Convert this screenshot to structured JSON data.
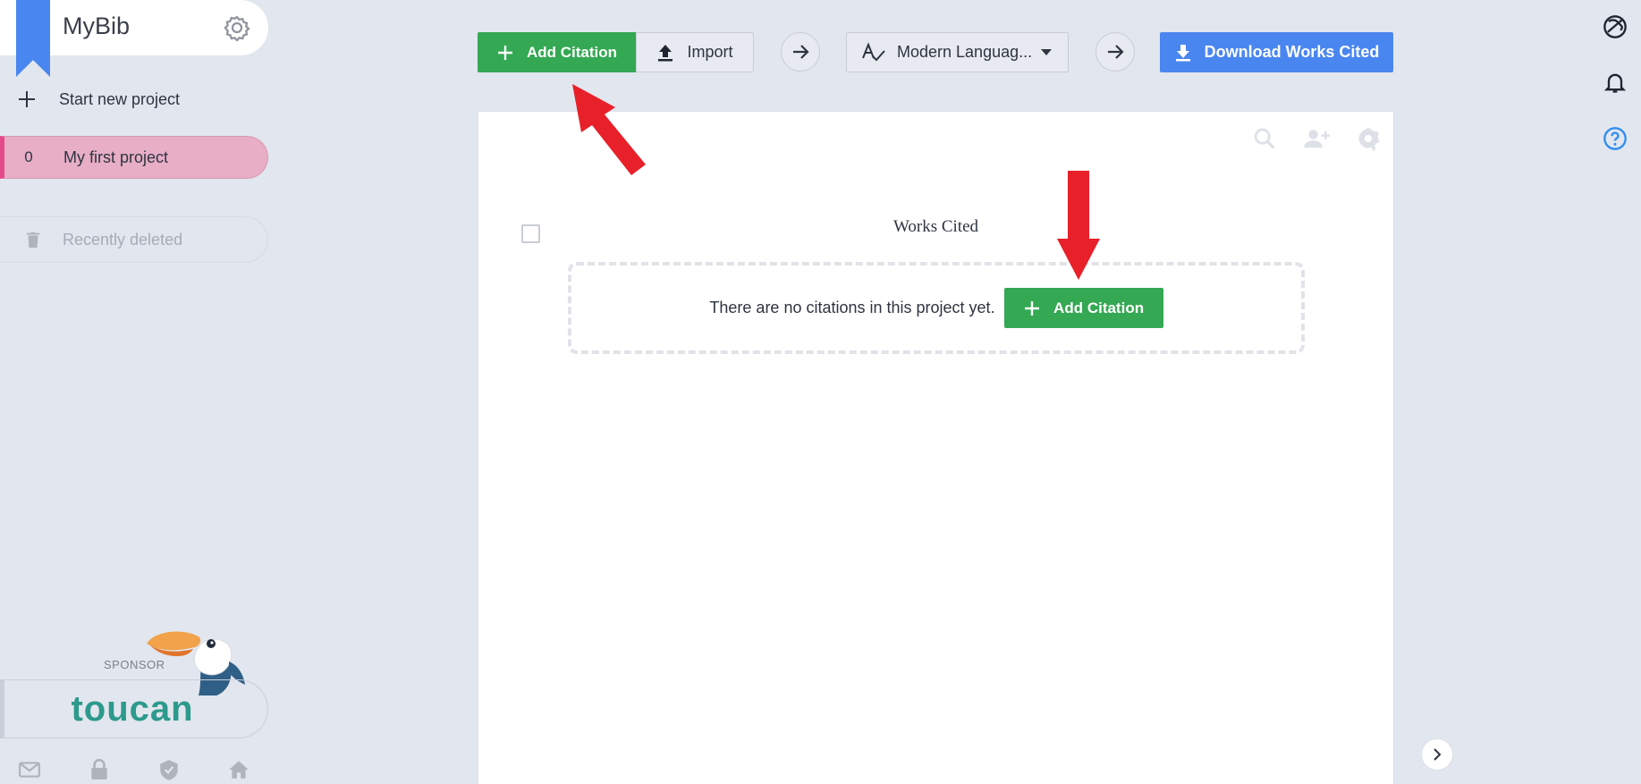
{
  "brand": {
    "name": "MyBib",
    "accent": "#4a86f0"
  },
  "sidebar": {
    "new_project_label": "Start new project",
    "projects": [
      {
        "count": "0",
        "name": "My first project"
      }
    ],
    "recently_deleted_label": "Recently deleted",
    "sponsor": {
      "label": "SPONSOR",
      "logo": "toucan"
    },
    "footer_icons": [
      "mail-icon",
      "lock-icon",
      "shield-icon",
      "home-icon"
    ]
  },
  "toolbar": {
    "add_citation_label": "Add Citation",
    "import_label": "Import",
    "citation_style": "Modern Languag...",
    "download_label": "Download Works Cited"
  },
  "document": {
    "title": "Works Cited",
    "empty_message": "There are no citations in this project yet.",
    "add_citation_label": "Add Citation"
  },
  "colors": {
    "green": "#34a853",
    "blue": "#4a86f0",
    "pink_active": "#e7aec6",
    "annotation_red": "#e8202a"
  }
}
